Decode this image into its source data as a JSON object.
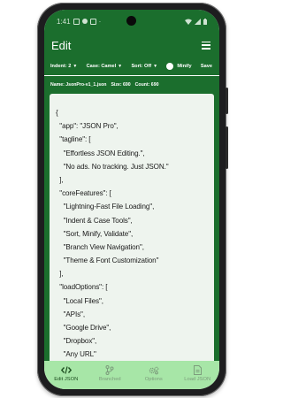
{
  "status_bar": {
    "time": "1:41"
  },
  "app_bar": {
    "title": "Edit",
    "menu_icon": "hamburger-menu-icon"
  },
  "toolbar": {
    "indent_label": "Indent: 2",
    "case_label": "Case: Camel",
    "sort_label": "Sort: Off",
    "minify_label": "Minify",
    "save_label": "Save"
  },
  "file_info": {
    "name": "Name: JsonPro-v1_1.json",
    "size": "Size: 690",
    "count": "Count: 690"
  },
  "editor_lines": [
    "{",
    "  \"app\": \"JSON Pro\",",
    "  \"tagline\": [",
    "    \"Effortless JSON Editing.\",",
    "    \"No ads. No tracking. Just JSON.\"",
    "  ],",
    "  \"coreFeatures\": [",
    "    \"Lightning-Fast File Loading\",",
    "    \"Indent & Case Tools\",",
    "    \"Sort, Minify, Validate\",",
    "    \"Branch View Navigation\",",
    "    \"Theme & Font Customization\"",
    "  ],",
    "  \"loadOptions\": [",
    "    \"Local Files\",",
    "    \"APIs\",",
    "    \"Google Drive\",",
    "    \"Dropbox\",",
    "    \"Any URL\""
  ],
  "bottom_nav": [
    {
      "label": "Edit JSON",
      "icon": "code-icon",
      "active": true
    },
    {
      "label": "Branched",
      "icon": "branch-icon",
      "active": false
    },
    {
      "label": "Options",
      "icon": "gears-icon",
      "active": false
    },
    {
      "label": "Load JSON",
      "icon": "file-icon",
      "active": false
    }
  ],
  "colors": {
    "primary": "#1b6e2d",
    "editor_bg": "#eef4ee",
    "nav_bg": "#a7e6a7",
    "nav_active": "#1f4f22",
    "nav_inactive": "#7c9c7c"
  }
}
